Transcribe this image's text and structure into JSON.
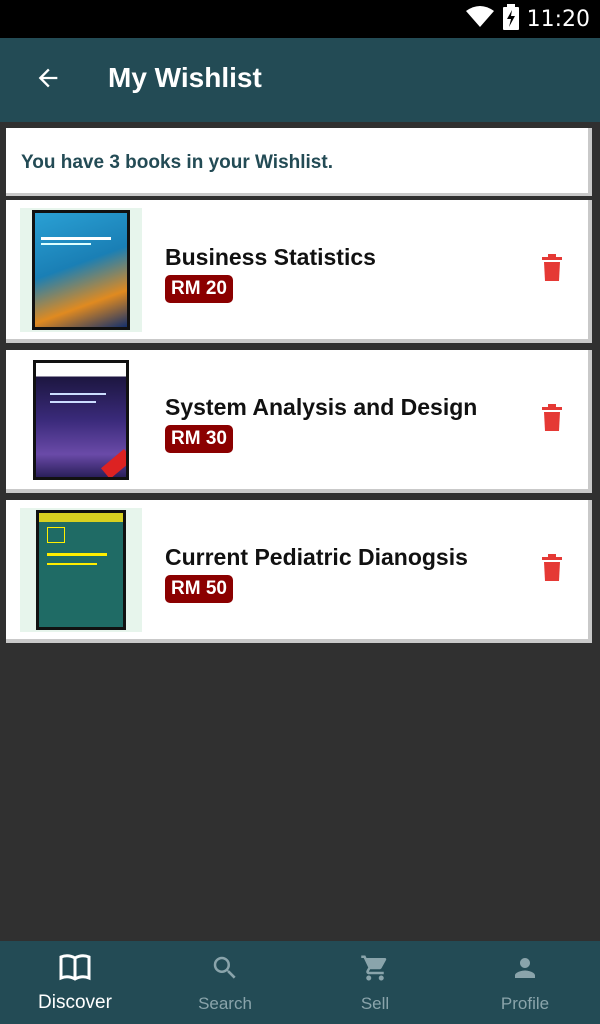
{
  "status_bar": {
    "time": "11:20",
    "icons": [
      "wifi-icon",
      "battery-charging-icon"
    ]
  },
  "header": {
    "title": "My Wishlist",
    "back_icon": "arrow-left-icon"
  },
  "wishlist": {
    "summary": "You have 3 books in your Wishlist.",
    "items": [
      {
        "title": "Business Statistics",
        "price": "RM 20",
        "cover_color": "#1a8cc0"
      },
      {
        "title": "System Analysis and Design",
        "price": "RM 30",
        "cover_color": "#2a1f5a"
      },
      {
        "title": "Current Pediatric Dianogsis",
        "price": "RM 50",
        "cover_color": "#1f6b65"
      }
    ]
  },
  "bottom_nav": {
    "items": [
      {
        "label": "Discover",
        "icon": "book-open-icon",
        "active": true
      },
      {
        "label": "Search",
        "icon": "search-icon",
        "active": false
      },
      {
        "label": "Sell",
        "icon": "cart-icon",
        "active": false
      },
      {
        "label": "Profile",
        "icon": "person-icon",
        "active": false
      }
    ]
  },
  "colors": {
    "primary": "#234b55",
    "price_badge": "#8b0000",
    "delete": "#e53935",
    "background": "#303030"
  }
}
